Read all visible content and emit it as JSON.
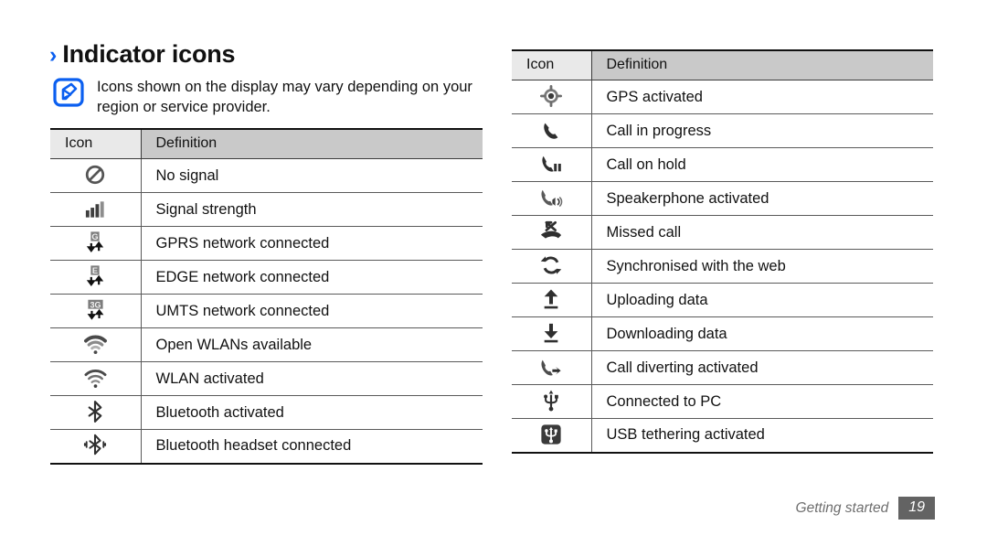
{
  "heading": {
    "chevron": "›",
    "title": "Indicator icons"
  },
  "note": {
    "icon": "note-pen-icon",
    "text": "Icons shown on the display may vary depending on your region or service provider."
  },
  "tables": [
    {
      "id": "left-table",
      "columns": [
        "Icon",
        "Definition"
      ],
      "rows": [
        {
          "icon": "no-signal-icon",
          "definition": "No signal"
        },
        {
          "icon": "signal-strength-icon",
          "definition": "Signal strength"
        },
        {
          "icon": "gprs-network-icon",
          "definition": "GPRS network connected"
        },
        {
          "icon": "edge-network-icon",
          "definition": "EDGE network connected"
        },
        {
          "icon": "umts-network-icon",
          "definition": "UMTS network connected"
        },
        {
          "icon": "open-wlan-icon",
          "definition": "Open WLANs available"
        },
        {
          "icon": "wlan-activated-icon",
          "definition": "WLAN activated"
        },
        {
          "icon": "bluetooth-activated-icon",
          "definition": "Bluetooth activated"
        },
        {
          "icon": "bluetooth-headset-icon",
          "definition": "Bluetooth headset connected"
        }
      ]
    },
    {
      "id": "right-table",
      "columns": [
        "Icon",
        "Definition"
      ],
      "rows": [
        {
          "icon": "gps-activated-icon",
          "definition": "GPS activated"
        },
        {
          "icon": "call-in-progress-icon",
          "definition": "Call in progress"
        },
        {
          "icon": "call-on-hold-icon",
          "definition": "Call on hold"
        },
        {
          "icon": "speakerphone-icon",
          "definition": "Speakerphone activated"
        },
        {
          "icon": "missed-call-icon",
          "definition": "Missed call"
        },
        {
          "icon": "sync-web-icon",
          "definition": "Synchronised with the web"
        },
        {
          "icon": "uploading-data-icon",
          "definition": "Uploading data"
        },
        {
          "icon": "downloading-data-icon",
          "definition": "Downloading data"
        },
        {
          "icon": "call-diverting-icon",
          "definition": "Call diverting activated"
        },
        {
          "icon": "connected-to-pc-icon",
          "definition": "Connected to PC"
        },
        {
          "icon": "usb-tethering-icon",
          "definition": "USB tethering activated"
        }
      ]
    }
  ],
  "footer": {
    "label": "Getting started",
    "page": "19"
  },
  "colors": {
    "accent_blue": "#0b5ff0",
    "header_icon_bg": "#e9e9e9",
    "header_def_bg": "#c9c9c9",
    "icon_gray": "#3f3f3f",
    "footer_gray": "#6e6e6e",
    "page_badge_bg": "#636363"
  }
}
